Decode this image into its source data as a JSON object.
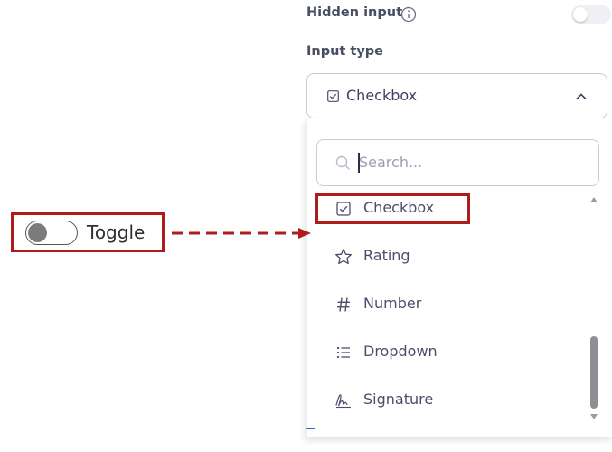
{
  "settings": {
    "hidden_input_label": "Hidden input",
    "input_type_label": "Input type",
    "selected_type": "Checkbox"
  },
  "dropdown": {
    "search_placeholder": "Search...",
    "options": [
      {
        "label": "Checkbox",
        "icon": "checkbox-icon"
      },
      {
        "label": "Rating",
        "icon": "star-icon"
      },
      {
        "label": "Number",
        "icon": "hash-icon"
      },
      {
        "label": "Dropdown",
        "icon": "list-icon"
      },
      {
        "label": "Signature",
        "icon": "signature-icon"
      }
    ]
  },
  "annotation": {
    "label": "Toggle",
    "highlight_color": "#b01c1c"
  }
}
